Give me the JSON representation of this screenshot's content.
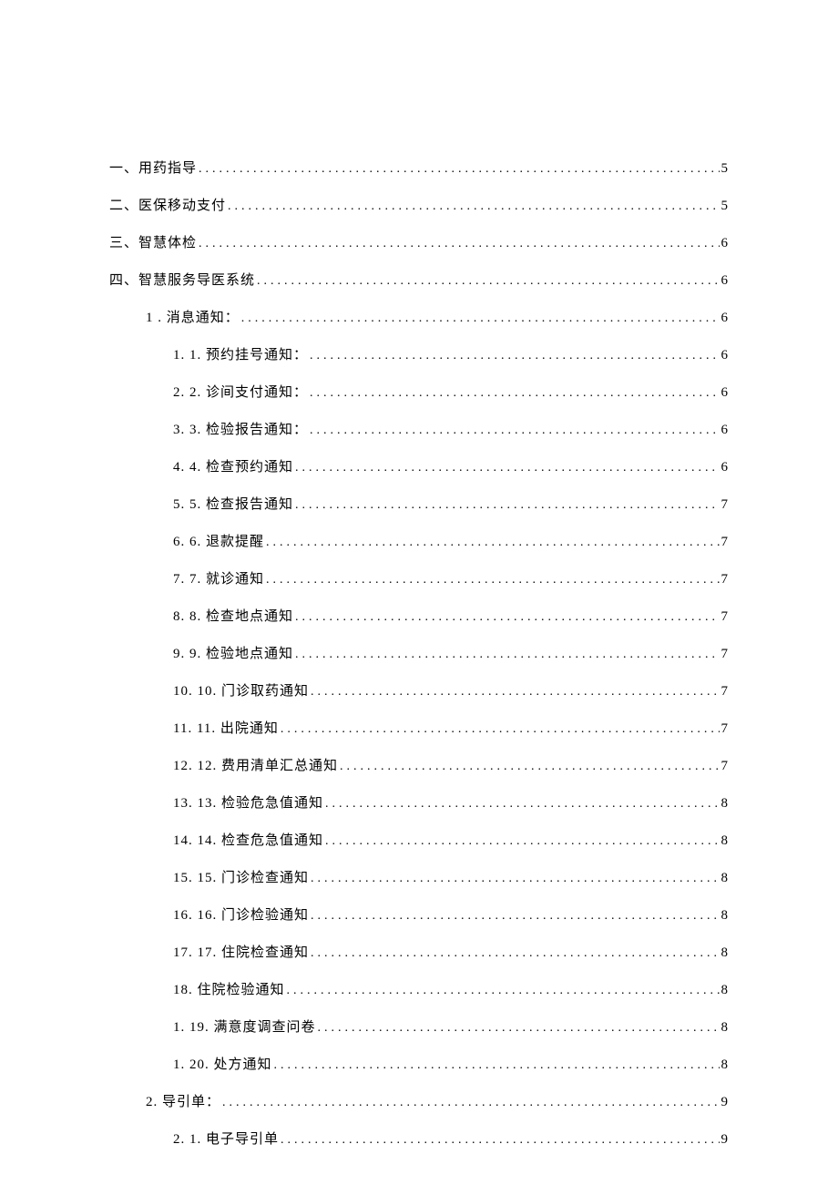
{
  "toc": [
    {
      "level": 1,
      "label": "一、用药指导 ",
      "page": "5"
    },
    {
      "level": 1,
      "label": "二、医保移动支付 ",
      "page": "5"
    },
    {
      "level": 1,
      "label": "三、智慧体检 ",
      "page": "6"
    },
    {
      "level": 1,
      "label": "四、智慧服务导医系统 ",
      "page": "6"
    },
    {
      "level": 2,
      "label": "1 . 消息通知： ",
      "page": "6"
    },
    {
      "level": 3,
      "label": "1.  1. 预约挂号通知：",
      "page": "6"
    },
    {
      "level": 3,
      "label": "2.  2. 诊间支付通知：",
      "page": "6"
    },
    {
      "level": 3,
      "label": "3.  3. 检验报告通知：",
      "page": "6"
    },
    {
      "level": 3,
      "label": "4.  4. 检查预约通知",
      "page": "6"
    },
    {
      "level": 3,
      "label": "5.  5. 检查报告通知",
      "page": "7"
    },
    {
      "level": 3,
      "label": "6.  6. 退款提醒",
      "page": "7"
    },
    {
      "level": 3,
      "label": "7.  7. 就诊通知",
      "page": "7"
    },
    {
      "level": 3,
      "label": "8.  8. 检查地点通知",
      "page": "7"
    },
    {
      "level": 3,
      "label": "9.  9. 检验地点通知",
      "page": "7"
    },
    {
      "level": 3,
      "label": "10. 10. 门诊取药通知",
      "page": "7"
    },
    {
      "level": 3,
      "label": "11. 11. 出院通知",
      "page": "7"
    },
    {
      "level": 3,
      "label": "12. 12. 费用清单汇总通知",
      "page": "7"
    },
    {
      "level": 3,
      "label": "13. 13. 检验危急值通知",
      "page": "8"
    },
    {
      "level": 3,
      "label": "14. 14. 检查危急值通知",
      "page": "8"
    },
    {
      "level": 3,
      "label": "15. 15. 门诊检查通知",
      "page": "8"
    },
    {
      "level": 3,
      "label": "16. 16. 门诊检验通知",
      "page": "8"
    },
    {
      "level": 3,
      "label": "17. 17. 住院检查通知",
      "page": "8"
    },
    {
      "level": 3,
      "label": "18. 住院检验通知",
      "page": "8"
    },
    {
      "level": 3,
      "label": "1. 19. 满意度调查问卷",
      "page": "8"
    },
    {
      "level": 3,
      "label": "1. 20. 处方通知",
      "page": "8"
    },
    {
      "level": 2,
      "label": "2. 导引单： ",
      "page": "9"
    },
    {
      "level": 3,
      "label": "2. 1. 电子导引单",
      "page": "9"
    }
  ]
}
